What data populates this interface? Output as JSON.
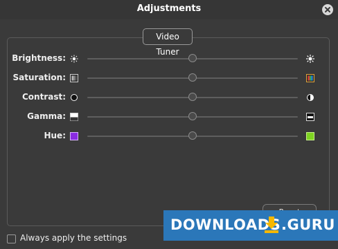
{
  "window": {
    "title": "Adjustments"
  },
  "group": {
    "title": "Video Tuner"
  },
  "sliders": [
    {
      "label": "Brightness:",
      "value": 0.5,
      "icon_left": "brightness-low-icon",
      "icon_right": "brightness-high-icon"
    },
    {
      "label": "Saturation:",
      "value": 0.5,
      "icon_left": "saturation-low-icon",
      "icon_right": "saturation-high-icon"
    },
    {
      "label": "Contrast:",
      "value": 0.5,
      "icon_left": "contrast-low-icon",
      "icon_right": "contrast-high-icon"
    },
    {
      "label": "Gamma:",
      "value": 0.5,
      "icon_left": "gamma-low-icon",
      "icon_right": "gamma-high-icon"
    },
    {
      "label": "Hue:",
      "value": 0.5,
      "icon_left": "hue-purple-icon",
      "icon_right": "hue-green-icon"
    }
  ],
  "buttons": {
    "reset": "Reset"
  },
  "checkbox": {
    "label": "Always apply the settings",
    "checked": false
  },
  "watermark": {
    "text_left": "DOWNLOADS",
    "text_right": ".GURU"
  },
  "colors": {
    "background": "#3a3a3a",
    "hue_left": "#8a2be2",
    "hue_right": "#7ed321",
    "watermark": "#2b77b9"
  }
}
